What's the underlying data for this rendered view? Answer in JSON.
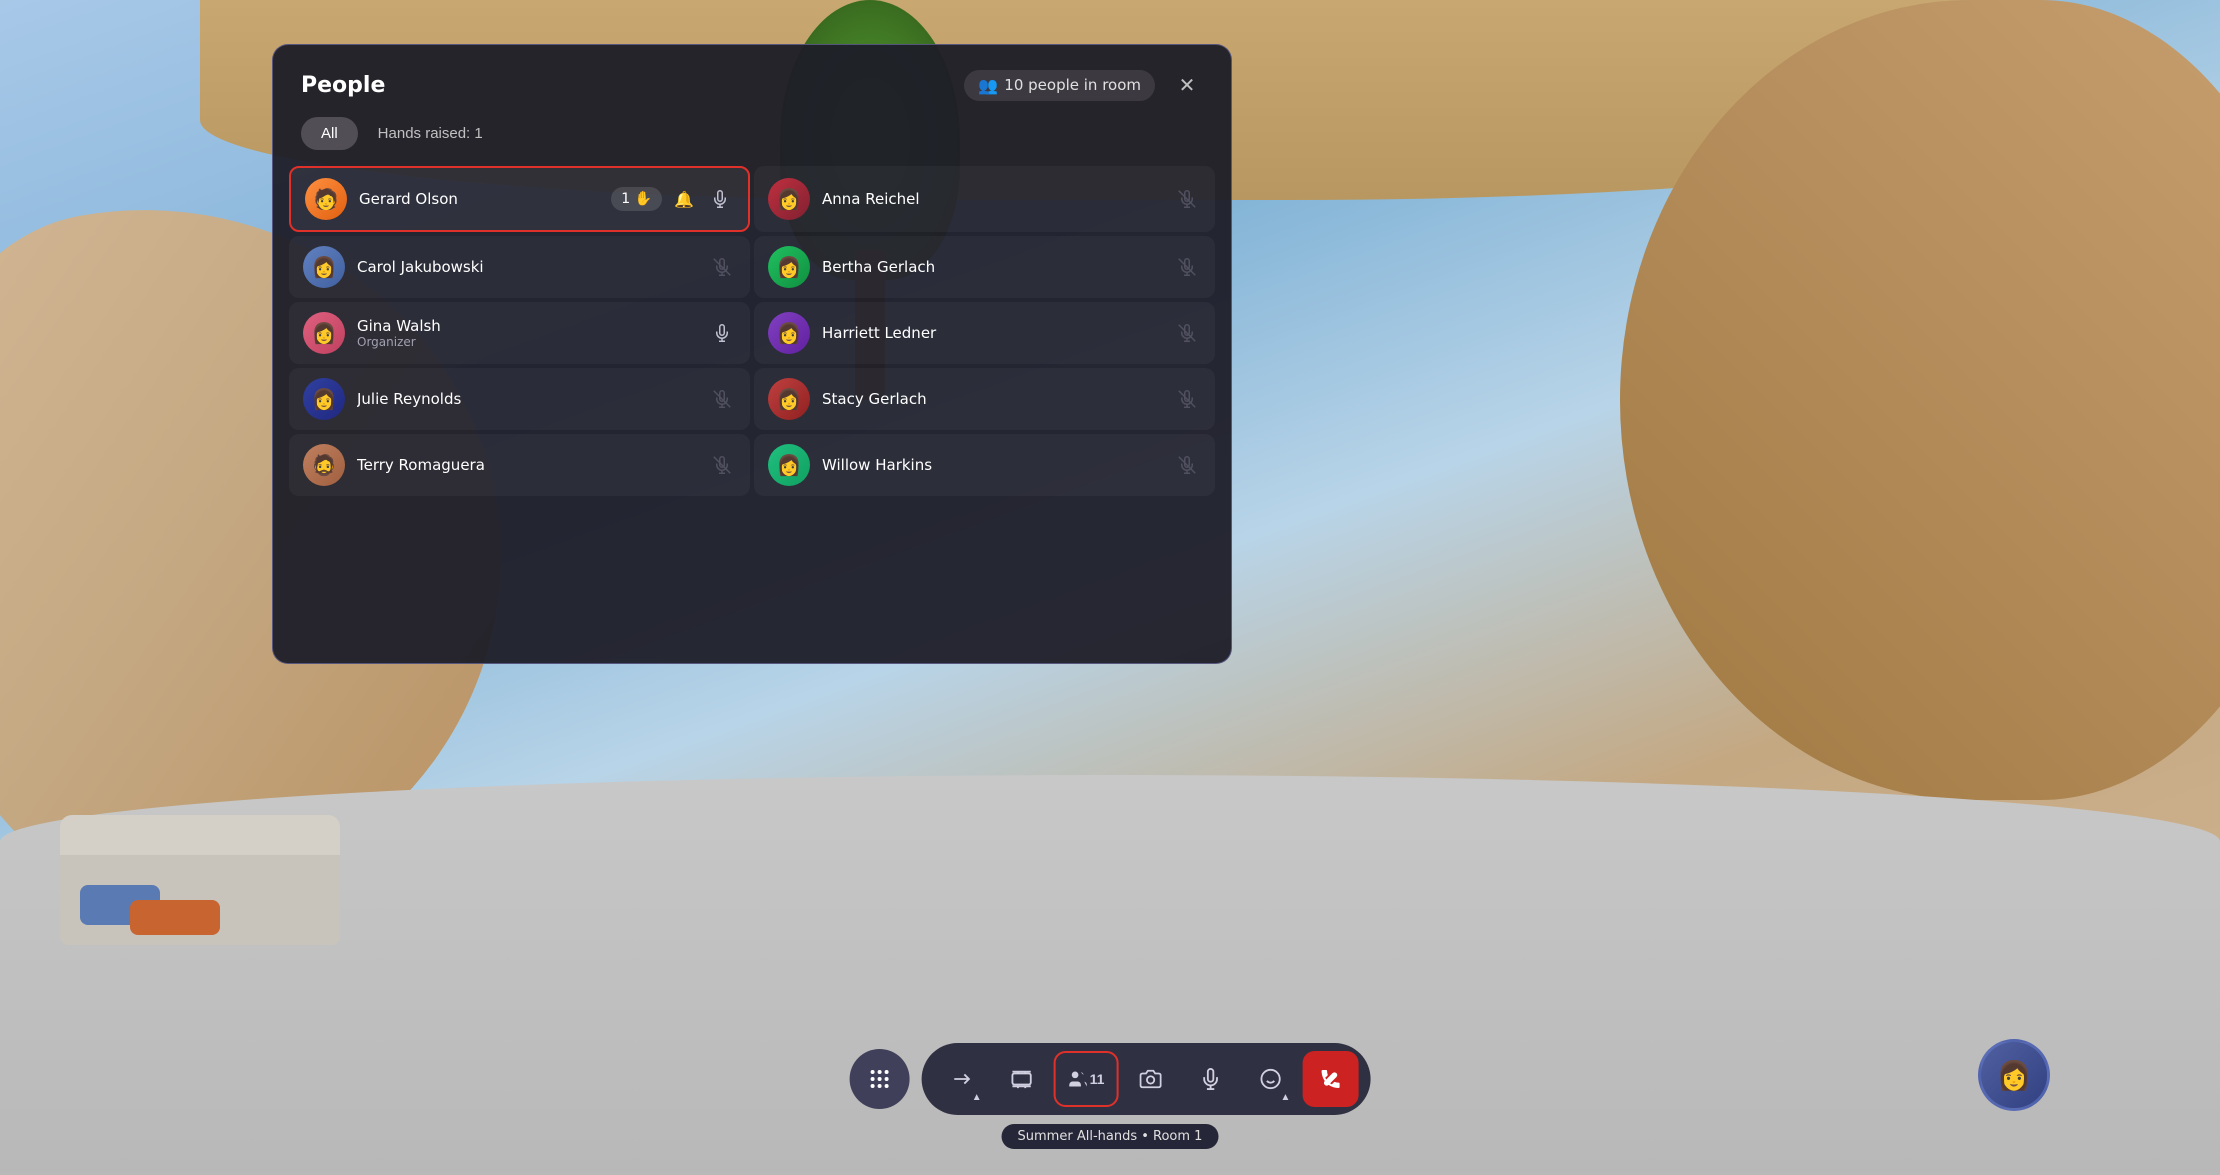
{
  "background": {
    "colors": {
      "sky": "#a8c8e8",
      "floor": "#c0c0c0",
      "wall": "#c4a882"
    }
  },
  "panel": {
    "title": "People",
    "people_count_label": "10 people in room",
    "tabs": [
      {
        "id": "all",
        "label": "All"
      },
      {
        "id": "hands",
        "label": "Hands raised: 1"
      }
    ],
    "people": [
      {
        "id": "gerard",
        "name": "Gerard Olson",
        "role": "",
        "avatar_class": "av-gerard",
        "avatar_emoji": "🧑",
        "highlighted": true,
        "hand_raised": true,
        "hand_count": "1",
        "mic": "on",
        "side": "left"
      },
      {
        "id": "anna",
        "name": "Anna Reichel",
        "role": "",
        "avatar_class": "av-anna",
        "avatar_emoji": "👩",
        "highlighted": false,
        "hand_raised": false,
        "mic": "muted",
        "side": "right"
      },
      {
        "id": "carol",
        "name": "Carol Jakubowski",
        "role": "",
        "avatar_class": "av-carol",
        "avatar_emoji": "👩",
        "highlighted": false,
        "hand_raised": false,
        "mic": "muted",
        "side": "left"
      },
      {
        "id": "bertha",
        "name": "Bertha Gerlach",
        "role": "",
        "avatar_class": "av-bertha",
        "avatar_emoji": "👩",
        "highlighted": false,
        "hand_raised": false,
        "mic": "muted",
        "side": "right"
      },
      {
        "id": "gina",
        "name": "Gina Walsh",
        "role": "Organizer",
        "avatar_class": "av-gina",
        "avatar_emoji": "👩",
        "highlighted": false,
        "hand_raised": false,
        "mic": "on",
        "side": "left"
      },
      {
        "id": "harriett",
        "name": "Harriett Ledner",
        "role": "",
        "avatar_class": "av-harriett",
        "avatar_emoji": "👩",
        "highlighted": false,
        "hand_raised": false,
        "mic": "muted",
        "side": "right"
      },
      {
        "id": "julie",
        "name": "Julie Reynolds",
        "role": "",
        "avatar_class": "av-julie",
        "avatar_emoji": "👩",
        "highlighted": false,
        "hand_raised": false,
        "mic": "muted",
        "side": "left"
      },
      {
        "id": "stacy",
        "name": "Stacy Gerlach",
        "role": "",
        "avatar_class": "av-stacy",
        "avatar_emoji": "👩",
        "highlighted": false,
        "hand_raised": false,
        "mic": "muted",
        "side": "right"
      },
      {
        "id": "terry",
        "name": "Terry Romaguera",
        "role": "",
        "avatar_class": "av-terry",
        "avatar_emoji": "🧔",
        "highlighted": false,
        "hand_raised": false,
        "mic": "muted",
        "side": "left"
      },
      {
        "id": "willow",
        "name": "Willow Harkins",
        "role": "",
        "avatar_class": "av-willow",
        "avatar_emoji": "👩",
        "highlighted": false,
        "hand_raised": false,
        "mic": "muted",
        "side": "right"
      }
    ]
  },
  "toolbar": {
    "grid_btn_label": "⠿",
    "buttons": [
      {
        "id": "share",
        "icon": "⬆",
        "label": "Share",
        "highlighted": false,
        "has_arrow": true
      },
      {
        "id": "film",
        "icon": "🎞",
        "label": "Film",
        "highlighted": false
      },
      {
        "id": "people",
        "icon": "👥",
        "label": "People",
        "count": "11",
        "highlighted": true
      },
      {
        "id": "camera",
        "icon": "📷",
        "label": "Camera",
        "highlighted": false
      },
      {
        "id": "mic",
        "icon": "🎤",
        "label": "Mic",
        "highlighted": false
      },
      {
        "id": "emoji",
        "icon": "😊",
        "label": "Emoji",
        "highlighted": false,
        "has_arrow": true
      },
      {
        "id": "end",
        "icon": "⏹",
        "label": "End",
        "highlighted": false,
        "is_red": true
      }
    ],
    "tooltip": "Summer All-hands • Room 1"
  }
}
